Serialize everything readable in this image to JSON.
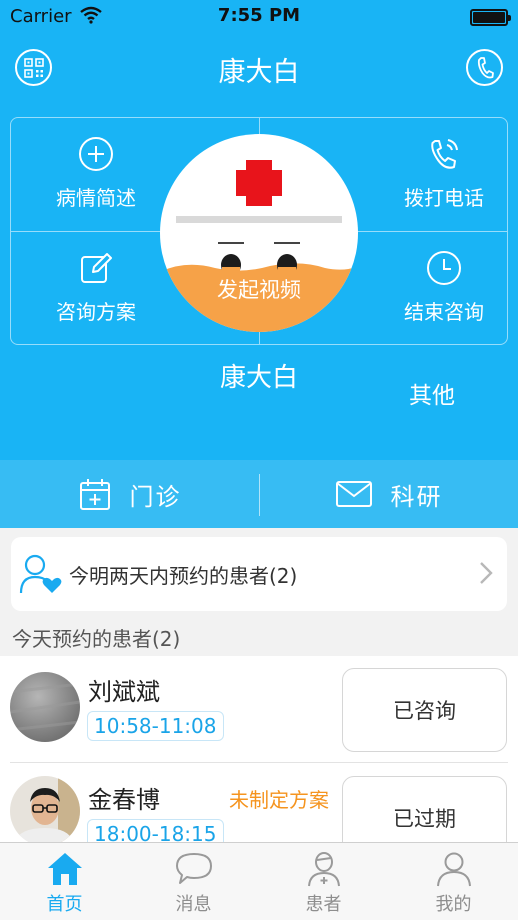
{
  "status_bar": {
    "carrier": "Carrier",
    "time": "7:55 PM"
  },
  "nav": {
    "title": "康大白"
  },
  "grid": {
    "cells": [
      {
        "label": "病情简述",
        "icon": "plus-circle-icon"
      },
      {
        "label": "拨打电话",
        "icon": "phone-call-icon"
      },
      {
        "label": "咨询方案",
        "icon": "edit-icon"
      },
      {
        "label": "结束咨询",
        "icon": "clock-icon"
      }
    ],
    "center": {
      "label": "发起视频",
      "icon": "baymax-icon"
    }
  },
  "robot_name": "康大白",
  "other_label": "其他",
  "tabs2": [
    {
      "label": "门诊",
      "icon": "calendar-plus-icon"
    },
    {
      "label": "科研",
      "icon": "mail-icon"
    }
  ],
  "banner": {
    "text": "今明两天内预约的患者(2)",
    "icon": "patient-heart-icon"
  },
  "section_title": "今天预约的患者(2)",
  "appointments": [
    {
      "name": "刘斌斌",
      "time": "10:58-11:08",
      "status": "已咨询",
      "warning": ""
    },
    {
      "name": "金春博",
      "time": "18:00-18:15",
      "status": "已过期",
      "warning": "未制定方案"
    }
  ],
  "tabbar": [
    {
      "label": "首页",
      "icon": "home-icon",
      "active": true
    },
    {
      "label": "消息",
      "icon": "chat-bubble-icon",
      "active": false
    },
    {
      "label": "患者",
      "icon": "patient-icon",
      "active": false
    },
    {
      "label": "我的",
      "icon": "user-icon",
      "active": false
    }
  ],
  "colors": {
    "primary": "#19b4f5",
    "accent": "#1aa4e8",
    "warning": "#f5941f",
    "cross": "#e8141b"
  }
}
